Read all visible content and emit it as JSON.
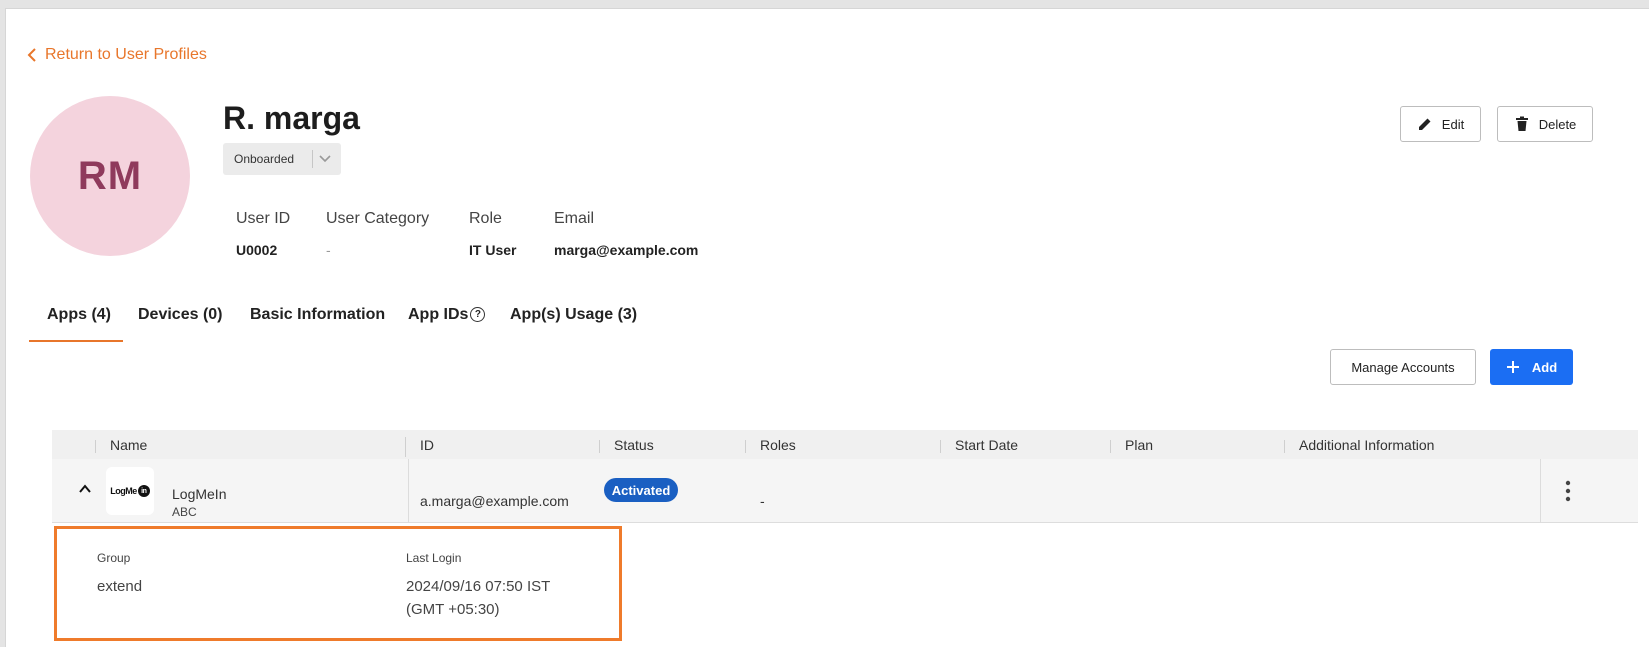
{
  "nav": {
    "back_label": "Return to User Profiles"
  },
  "profile": {
    "initials": "RM",
    "name": "R. marga",
    "status": "Onboarded",
    "fields": [
      {
        "label": "User ID",
        "value": "U0002"
      },
      {
        "label": "User Category",
        "value": "-"
      },
      {
        "label": "Role",
        "value": "IT User"
      },
      {
        "label": "Email",
        "value": "marga@example.com"
      }
    ]
  },
  "actions": {
    "edit_label": "Edit",
    "delete_label": "Delete"
  },
  "tabs": [
    {
      "label": "Apps (4)",
      "active": true
    },
    {
      "label": "Devices (0)"
    },
    {
      "label": "Basic Information"
    },
    {
      "label": "App IDs"
    },
    {
      "label": "App(s) Usage (3)"
    }
  ],
  "toolbar": {
    "manage_label": "Manage Accounts",
    "add_label": "Add"
  },
  "table": {
    "columns": [
      "Name",
      "ID",
      "Status",
      "Roles",
      "Start Date",
      "Plan",
      "Additional Information"
    ],
    "rows": [
      {
        "app_name": "LogMeIn",
        "app_sub": "ABC",
        "logo_text": "LogMe",
        "logo_badge": "in",
        "id": "a.marga@example.com",
        "status": "Activated",
        "roles": "-",
        "details": {
          "group_label": "Group",
          "group_value": "extend",
          "last_login_label": "Last Login",
          "last_login_line1": "2024/09/16 07:50 IST",
          "last_login_line2": "(GMT +05:30)"
        }
      }
    ]
  },
  "colors": {
    "accent": "#e8762b",
    "primary": "#1b6ef3",
    "badge": "#1a5fc2",
    "avatar_bg": "#f4d3dd"
  }
}
